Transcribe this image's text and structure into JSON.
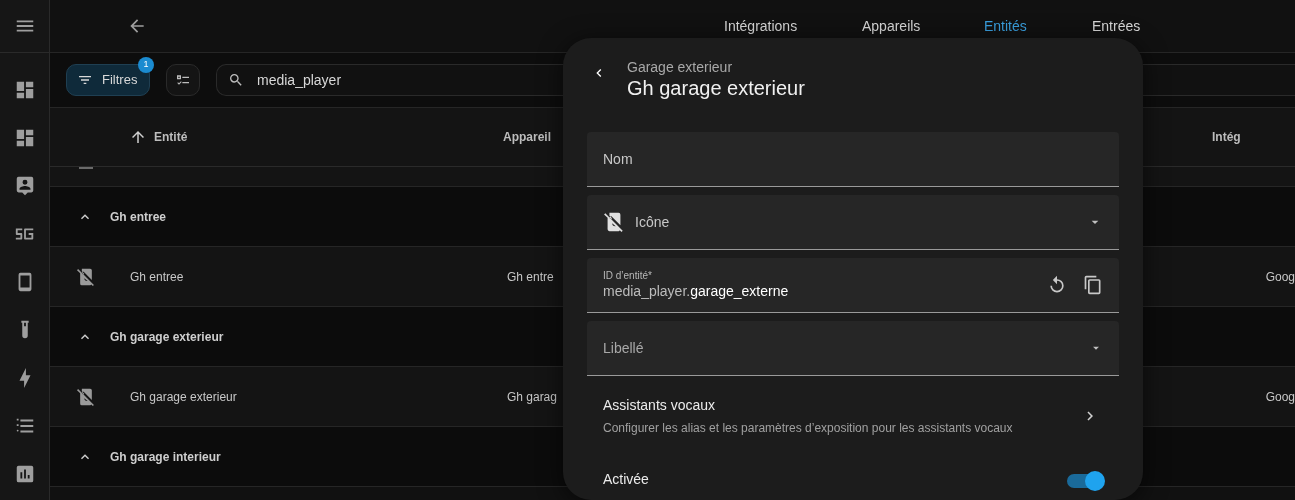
{
  "top_bar": {
    "tabs": [
      {
        "label": "Intégrations",
        "selected": false
      },
      {
        "label": "Appareils",
        "selected": false
      },
      {
        "label": "Entités",
        "selected": true
      },
      {
        "label": "Entrées",
        "selected": false
      }
    ]
  },
  "toolbar": {
    "filter_button": {
      "label": "Filtres",
      "badge": "1"
    },
    "search": {
      "value": "media_player"
    }
  },
  "table": {
    "columns": [
      "Entité",
      "Appareil",
      "Intég"
    ],
    "groups": [
      {
        "title": "Gh entree",
        "expanded": true,
        "rows": [
          {
            "name": "Gh entree",
            "device": "Gh entre",
            "integration": "Goog"
          }
        ]
      },
      {
        "title": "Gh garage exterieur",
        "expanded": true,
        "rows": [
          {
            "name": "Gh garage exterieur",
            "device": "Gh garag",
            "integration": "Goog"
          }
        ]
      },
      {
        "title": "Gh garage interieur",
        "expanded": true
      }
    ]
  },
  "dialog": {
    "breadcrumb": "Garage exterieur",
    "title": "Gh garage exterieur",
    "fields": [
      {
        "kind": "text",
        "label": "Nom"
      },
      {
        "kind": "icon_select",
        "label": "Icône"
      },
      {
        "kind": "entity_id",
        "label": "ID d’entité*",
        "value_prefix": "media_player.",
        "value": "garage_externe"
      },
      {
        "kind": "select",
        "label": "Libellé"
      }
    ],
    "voice_assistants": {
      "title": "Assistants vocaux",
      "description": "Configurer les alias et les paramètres d’exposition pour les assistants vocaux"
    },
    "enabled": {
      "label": "Activée",
      "on": true
    }
  }
}
